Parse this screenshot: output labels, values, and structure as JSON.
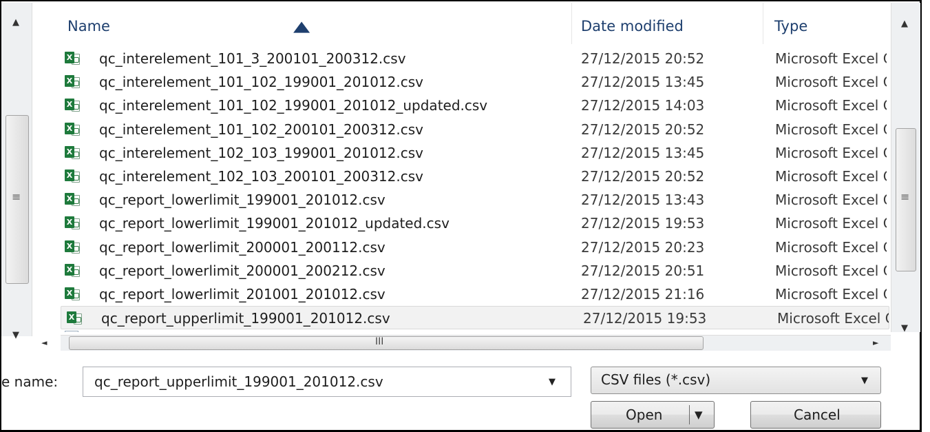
{
  "columns": {
    "name": "Name",
    "date": "Date modified",
    "type": "Type"
  },
  "files": [
    {
      "name": "qc_interelement_101_3_200101_200312.csv",
      "date": "27/12/2015 20:52",
      "type": "Microsoft Excel Comma Separated Values File"
    },
    {
      "name": "qc_interelement_101_102_199001_201012.csv",
      "date": "27/12/2015 13:45",
      "type": "Microsoft Excel Comma Separated Values File"
    },
    {
      "name": "qc_interelement_101_102_199001_201012_updated.csv",
      "date": "27/12/2015 14:03",
      "type": "Microsoft Excel Comma Separated Values File"
    },
    {
      "name": "qc_interelement_101_102_200101_200312.csv",
      "date": "27/12/2015 20:52",
      "type": "Microsoft Excel Comma Separated Values File"
    },
    {
      "name": "qc_interelement_102_103_199001_201012.csv",
      "date": "27/12/2015 13:45",
      "type": "Microsoft Excel Comma Separated Values File"
    },
    {
      "name": "qc_interelement_102_103_200101_200312.csv",
      "date": "27/12/2015 20:52",
      "type": "Microsoft Excel Comma Separated Values File"
    },
    {
      "name": "qc_report_lowerlimit_199001_201012.csv",
      "date": "27/12/2015 13:43",
      "type": "Microsoft Excel Comma Separated Values File"
    },
    {
      "name": "qc_report_lowerlimit_199001_201012_updated.csv",
      "date": "27/12/2015 19:53",
      "type": "Microsoft Excel Comma Separated Values File"
    },
    {
      "name": "qc_report_lowerlimit_200001_200112.csv",
      "date": "27/12/2015 20:23",
      "type": "Microsoft Excel Comma Separated Values File"
    },
    {
      "name": "qc_report_lowerlimit_200001_200212.csv",
      "date": "27/12/2015 20:51",
      "type": "Microsoft Excel Comma Separated Values File"
    },
    {
      "name": "qc_report_lowerlimit_201001_201012.csv",
      "date": "27/12/2015 21:16",
      "type": "Microsoft Excel Comma Separated Values File"
    },
    {
      "name": "qc_report_upperlimit_199001_201012.csv",
      "date": "27/12/2015 19:53",
      "type": "Microsoft Excel Comma Separated Values File",
      "selected": true
    }
  ],
  "file_icon": "excel-csv-icon",
  "form": {
    "filename_label": "e name:",
    "filename_value": "qc_report_upperlimit_199001_201012.csv",
    "filetype_value": "CSV files (*.csv)",
    "open_label": "Open",
    "cancel_label": "Cancel"
  },
  "scroll_glyphs": {
    "grip": "≡",
    "hgrip": "III"
  },
  "colors": {
    "header_text": "#1e3f6e",
    "excel_green": "#1e7a3c",
    "selection": "#f2f2f2"
  }
}
